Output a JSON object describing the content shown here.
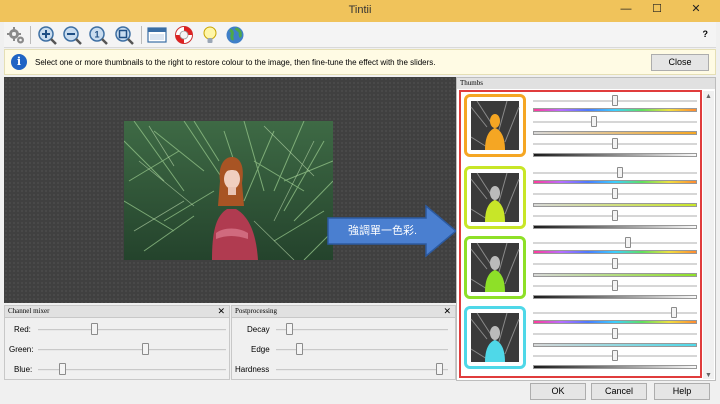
{
  "window": {
    "title": "Tintii",
    "minimize": "—",
    "maximize": "☐",
    "close": "✕"
  },
  "toolbar": {
    "icons": [
      "settings-gears-icon",
      "zoom-in-icon",
      "zoom-out-icon",
      "zoom-fit-icon",
      "zoom-actual-icon",
      "window-icon",
      "lifebuoy-icon",
      "lightbulb-icon",
      "globe-icon"
    ],
    "help": "?"
  },
  "info": {
    "text": "Select one or more thumbnails to the right to restore colour to the image, then fine-tune the effect with the sliders.",
    "close_label": "Close"
  },
  "annotation": {
    "text": "強調單一色彩."
  },
  "channel_mixer": {
    "title": "Channel mixer",
    "rows": [
      {
        "label": "Red:",
        "value": 0.2
      },
      {
        "label": "Green:",
        "value": 0.54
      },
      {
        "label": "Blue:",
        "value": 0.08
      }
    ]
  },
  "postprocessing": {
    "title": "Postprocessing",
    "rows": [
      {
        "label": "Decay",
        "value": 0.06
      },
      {
        "label": "Edge",
        "value": 0.13
      },
      {
        "label": "Hardness",
        "value": 0.97
      }
    ]
  },
  "thumbs": {
    "title": "Thumbs",
    "items": [
      {
        "color": "#f5a623",
        "sliders": [
          0.5,
          0.37,
          0.5
        ]
      },
      {
        "color": "#c8e628",
        "sliders": [
          0.53,
          0.5,
          0.5
        ]
      },
      {
        "color": "#8ee028",
        "sliders": [
          0.58,
          0.5,
          0.5
        ]
      },
      {
        "color": "#4fd8e8",
        "sliders": [
          0.86,
          0.5,
          0.5
        ]
      }
    ]
  },
  "buttons": {
    "ok": "OK",
    "cancel": "Cancel",
    "help": "Help"
  }
}
